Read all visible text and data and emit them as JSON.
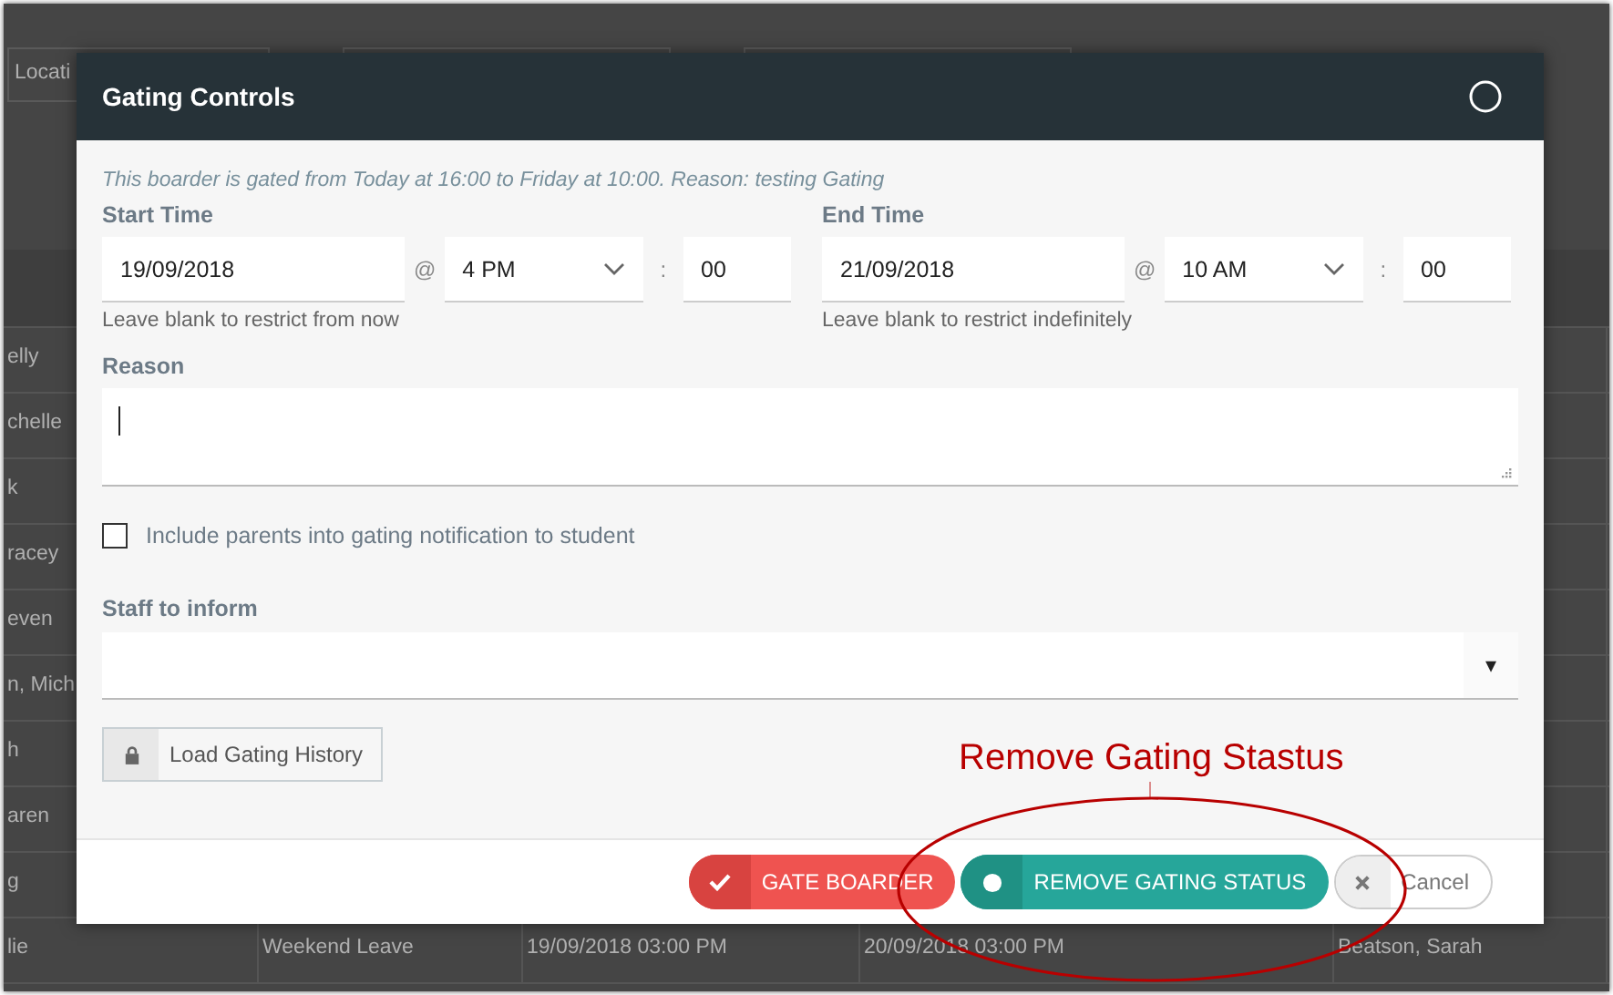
{
  "background": {
    "filter_label": "Locati",
    "rows": [
      {
        "cells": [
          "elly"
        ]
      },
      {
        "cells": [
          "chelle"
        ]
      },
      {
        "cells": [
          "k"
        ]
      },
      {
        "cells": [
          "racey"
        ]
      },
      {
        "cells": [
          "even"
        ]
      },
      {
        "cells": [
          "n, Mich"
        ]
      },
      {
        "cells": [
          "h"
        ]
      },
      {
        "cells": [
          "aren"
        ]
      },
      {
        "cells": [
          "g"
        ]
      },
      {
        "cells": [
          "lie",
          "Weekend Leave",
          "19/09/2018 03:00 PM",
          "20/09/2018 03:00 PM",
          "Beatson, Sarah"
        ]
      }
    ]
  },
  "dialog": {
    "title": "Gating Controls",
    "notice": "This boarder is gated from Today at 16:00 to Friday at 10:00. Reason: testing Gating",
    "times": [
      {
        "label": "Start Time",
        "date": "19/09/2018",
        "at": "@",
        "hour": "4 PM",
        "colon": ":",
        "minute": "00",
        "hint": "Leave blank to restrict from now"
      },
      {
        "label": "End Time",
        "date": "21/09/2018",
        "at": "@",
        "hour": "10 AM",
        "colon": ":",
        "minute": "00",
        "hint": "Leave blank to restrict indefinitely"
      }
    ],
    "reason": {
      "label": "Reason",
      "focused": true
    },
    "include_parents": {
      "label": "Include parents into gating notification to student",
      "checked": false
    },
    "staff": {
      "label": "Staff to inform",
      "arrow": "▾"
    },
    "history_button": "Load Gating History",
    "buttons": [
      {
        "kind": "danger",
        "label": "GATE BOARDER"
      },
      {
        "kind": "success",
        "label": "REMOVE GATING STATUS"
      },
      {
        "kind": "cancel",
        "label": "Cancel"
      }
    ]
  },
  "annotation": {
    "text": "Remove Gating Stastus"
  }
}
